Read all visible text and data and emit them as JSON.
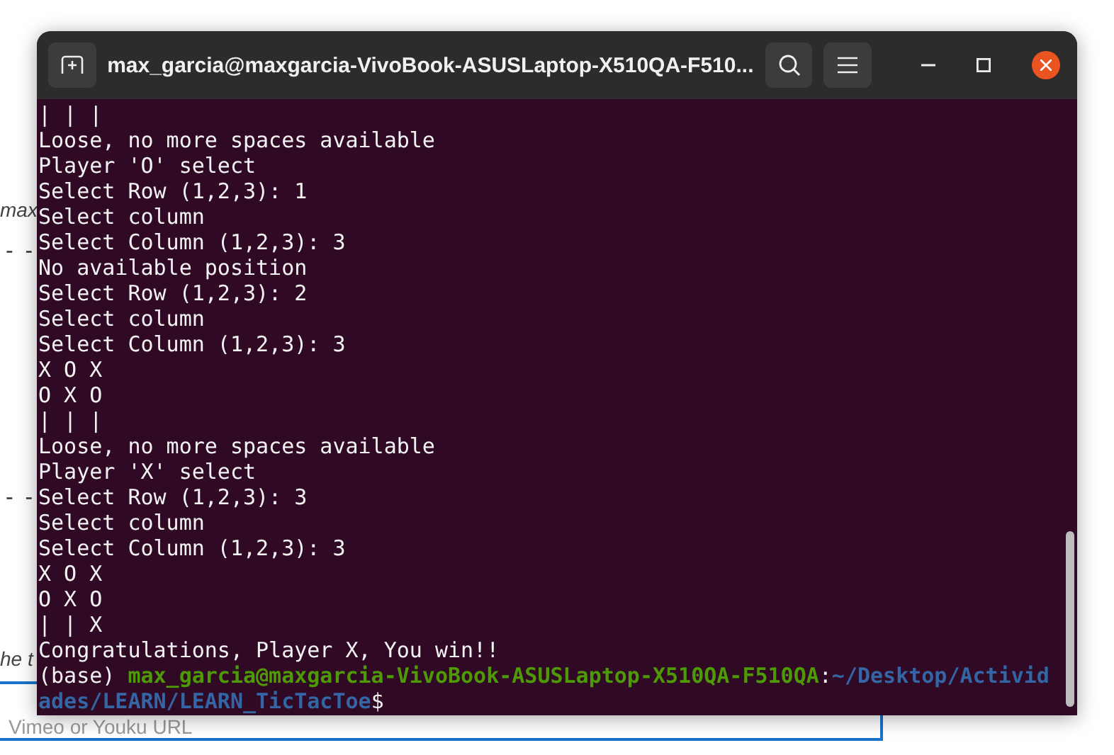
{
  "background_page": {
    "fragments": [
      {
        "kind": "italic",
        "text": "max"
      },
      {
        "kind": "dashes",
        "text": "- -"
      },
      {
        "kind": "dashes",
        "text": "- -"
      },
      {
        "kind": "italic",
        "text": "he t"
      }
    ],
    "url_field": {
      "placeholder": "Vimeo or Youku URL"
    }
  },
  "terminal": {
    "title": "max_garcia@maxgarcia-VivoBook-ASUSLaptop-X510QA-F510...",
    "lines": [
      "| | |",
      "Loose, no more spaces available",
      "Player 'O' select",
      "Select Row (1,2,3): 1",
      "Select column",
      "Select Column (1,2,3): 3",
      "No available position",
      "Select Row (1,2,3): 2",
      "Select column",
      "Select Column (1,2,3): 3",
      "X O X",
      "O X O",
      "| | |",
      "Loose, no more spaces available",
      "Player 'X' select",
      "Select Row (1,2,3): 3",
      "Select column",
      "Select Column (1,2,3): 3",
      "X O X",
      "O X O",
      "| | X",
      "Congratulations, Player X, You win!!"
    ],
    "prompt": {
      "env": "(base) ",
      "user_host": "max_garcia@maxgarcia-VivoBook-ASUSLaptop-X510QA-F510QA",
      "separator": ":",
      "path": "~/Desktop/Actividades/LEARN/LEARN_TicTacToe",
      "symbol": "$"
    }
  }
}
